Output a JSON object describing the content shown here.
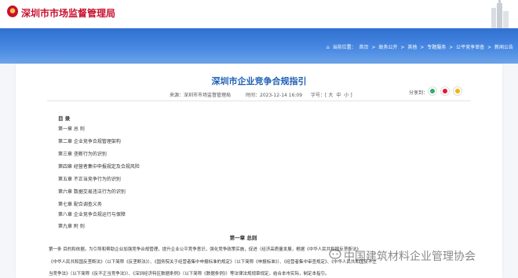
{
  "header": {
    "site_title": "深圳市市场监督管理局"
  },
  "breadcrumb": {
    "prefix": "当前位置：",
    "items": [
      "首页",
      "政务公开",
      "其他",
      "专题服务",
      "公平竞争审查",
      "新闻公告"
    ],
    "separator": " > "
  },
  "article": {
    "title": "深圳市企业竞争合规指引",
    "source": "来源：深圳市市场监督管理局",
    "time": "时间：2023-12-14 16:09",
    "font_label": "字号：[",
    "font_large": "大",
    "font_medium": "中",
    "font_small": "小",
    "font_close": "]",
    "share_label": "分享到："
  },
  "toc": {
    "title": "目  录",
    "items": [
      "第一章 总  则",
      "第二章 企业竞争合规管理架构",
      "第三章 垄断行为的识别",
      "第四章 经营者集中申报规定及合规风险",
      "第五章 不正当竞争行为的识别",
      "第六章 数据交易违法行为的识别",
      "第七章 配合调查义务",
      "第八章 企业竞争合规运行与保障",
      "第九章 附  则"
    ]
  },
  "body": {
    "chapter_heading": "第一章 总则",
    "paragraphs": [
      "第一条  目的和依据。为引导和帮助企业加强竞争合规管理，提升企业公平竞争意识，强化竞争政策实施，促进（经济高质量发展，根据《中华人民共和国反垄断法》",
      "《中华人民共和国反垄断法》（以下简称《反垄断法》）、《国务院关于经营者集中申报标准的规定》（以下简称《申报标准》）、《经营者集中审查规定》、《中华人民共和国反不正",
      "当竞争法》（以下简称《反不正当竞争法》）、《深圳经济特区数据条例》（以下简称《数据条例》）等法律法规规章规定，结合本市实际，制定本指引。"
    ]
  },
  "watermark": {
    "text": "中国建筑材料企业管理协会"
  },
  "colors": {
    "brand_red": "#c8102e",
    "banner_blue": "#2f6fd0",
    "title_blue": "#1d5fb4",
    "wechat_green": "#2aae67",
    "weibo_red": "#e6162d",
    "qzone_yellow": "#f5b400"
  }
}
